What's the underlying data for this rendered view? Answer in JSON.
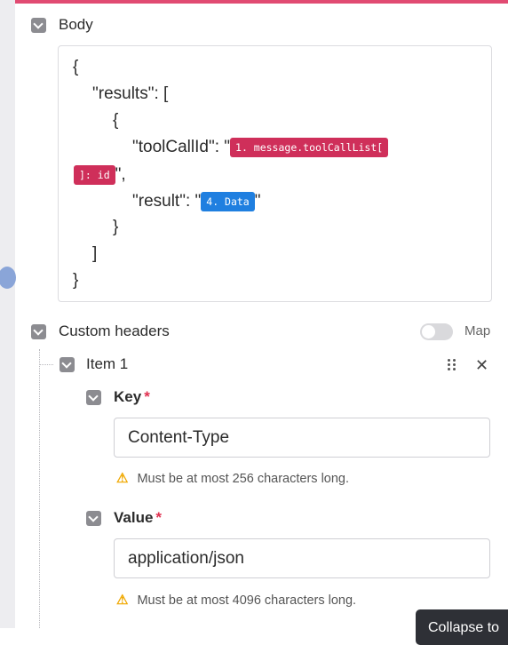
{
  "body_section": {
    "label": "Body",
    "code_lines": {
      "open_brace": "{",
      "results_key": "\"results\": [",
      "item_open": "{",
      "toolcall_key": "\"toolCallId\": \"",
      "toolcall_pill_part1": "1. message.toolCallList[",
      "toolcall_pill_part2": "]: id",
      "toolcall_end": "\",",
      "result_key": "\"result\": \"",
      "result_pill": "4. Data",
      "result_end": "\"",
      "item_close": "}",
      "array_close": "]",
      "close_brace": "}"
    }
  },
  "custom_headers": {
    "label": "Custom headers",
    "map_label": "Map",
    "map_enabled": false,
    "item": {
      "label": "Item 1",
      "key": {
        "label": "Key",
        "required_mark": "*",
        "value": "Content-Type",
        "warning": "Must be at most 256 characters long."
      },
      "value": {
        "label": "Value",
        "required_mark": "*",
        "value": "application/json",
        "warning": "Must be at most 4096 characters long."
      }
    }
  },
  "tooltip": {
    "text": "Collapse to"
  },
  "colors": {
    "pill_red": "#cf2f5a",
    "pill_blue": "#1f7fe0",
    "accent_top": "#e14b72",
    "warning": "#f0a800"
  },
  "icons": {
    "warning": "warning-icon",
    "drag": "drag-handle-icon",
    "close": "close-icon",
    "check": "checkbox-checked-icon"
  }
}
